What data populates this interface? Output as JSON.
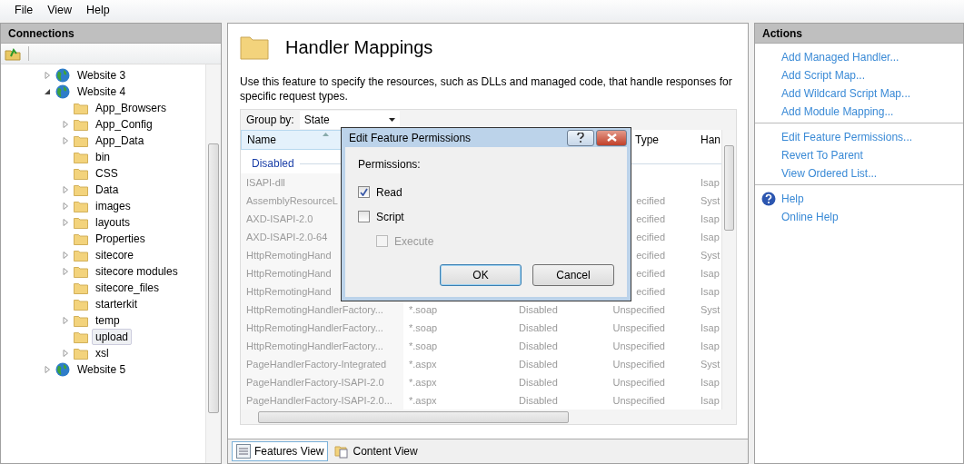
{
  "menu": [
    "File",
    "View",
    "Help"
  ],
  "connections": {
    "title": "Connections",
    "tree": [
      {
        "label": "Website 3",
        "kind": "site",
        "expanded": false,
        "selected": false
      },
      {
        "label": "Website 4",
        "kind": "site",
        "expanded": true,
        "selected": false,
        "children": [
          {
            "label": "App_Browsers",
            "kind": "folder",
            "selected": false
          },
          {
            "label": "App_Config",
            "kind": "folder",
            "expanded": false,
            "selected": false
          },
          {
            "label": "App_Data",
            "kind": "folder",
            "expanded": false,
            "selected": false
          },
          {
            "label": "bin",
            "kind": "folder",
            "selected": false
          },
          {
            "label": "CSS",
            "kind": "folder",
            "selected": false
          },
          {
            "label": "Data",
            "kind": "folder",
            "expanded": false,
            "selected": false
          },
          {
            "label": "images",
            "kind": "folder",
            "expanded": false,
            "selected": false
          },
          {
            "label": "layouts",
            "kind": "folder",
            "expanded": false,
            "selected": false
          },
          {
            "label": "Properties",
            "kind": "folder",
            "selected": false
          },
          {
            "label": "sitecore",
            "kind": "folder",
            "expanded": false,
            "selected": false
          },
          {
            "label": "sitecore modules",
            "kind": "folder",
            "expanded": false,
            "selected": false
          },
          {
            "label": "sitecore_files",
            "kind": "folder",
            "selected": false
          },
          {
            "label": "starterkit",
            "kind": "folder",
            "selected": false
          },
          {
            "label": "temp",
            "kind": "folder",
            "expanded": false,
            "selected": false
          },
          {
            "label": "upload",
            "kind": "folder",
            "selected": true
          },
          {
            "label": "xsl",
            "kind": "folder",
            "expanded": false,
            "selected": false
          }
        ]
      },
      {
        "label": "Website 5",
        "kind": "site",
        "expanded": false,
        "selected": false
      }
    ]
  },
  "feature": {
    "title": "Handler Mappings",
    "description": "Use this feature to specify the resources, such as DLLs and managed code, that handle responses for specific request types.",
    "group_by": {
      "label": "Group by:",
      "value": "State"
    },
    "table": {
      "columns": [
        {
          "label": "Name",
          "sorted": true
        },
        {
          "label": "Type",
          "sorted": false
        },
        {
          "label": "Han",
          "sorted": false
        }
      ],
      "group": "Disabled",
      "rows": [
        {
          "name": "ISAPI-dll",
          "handler": "Isap"
        },
        {
          "name": "AssemblyResourceL",
          "type": "ecified",
          "handler": "Syst"
        },
        {
          "name": "AXD-ISAPI-2.0",
          "type": "ecified",
          "handler": "Isap"
        },
        {
          "name": "AXD-ISAPI-2.0-64",
          "type": "ecified",
          "handler": "Isap"
        },
        {
          "name": "HttpRemotingHand",
          "type": "ecified",
          "handler": "Syst"
        },
        {
          "name": "HttpRemotingHand",
          "type": "ecified",
          "handler": "Isap"
        },
        {
          "name": "HttpRemotingHand",
          "type": "ecified",
          "handler": "Isap"
        },
        {
          "name": "HttpRemotingHandlerFactory...",
          "path": "*.soap",
          "state": "Disabled",
          "type": "Unspecified",
          "handler": "Syst"
        },
        {
          "name": "HttpRemotingHandlerFactory...",
          "path": "*.soap",
          "state": "Disabled",
          "type": "Unspecified",
          "handler": "Isap"
        },
        {
          "name": "HttpRemotingHandlerFactory...",
          "path": "*.soap",
          "state": "Disabled",
          "type": "Unspecified",
          "handler": "Isap"
        },
        {
          "name": "PageHandlerFactory-Integrated",
          "path": "*.aspx",
          "state": "Disabled",
          "type": "Unspecified",
          "handler": "Syst"
        },
        {
          "name": "PageHandlerFactory-ISAPI-2.0",
          "path": "*.aspx",
          "state": "Disabled",
          "type": "Unspecified",
          "handler": "Isap"
        },
        {
          "name": "PageHandlerFactory-ISAPI-2.0...",
          "path": "*.aspx",
          "state": "Disabled",
          "type": "Unspecified",
          "handler": "Isap"
        }
      ]
    }
  },
  "dialog": {
    "title": "Edit Feature Permissions",
    "label": "Permissions:",
    "options": [
      {
        "label": "Read",
        "checked": true,
        "disabled": false
      },
      {
        "label": "Script",
        "checked": false,
        "disabled": false,
        "children": [
          {
            "label": "Execute",
            "checked": false,
            "disabled": true
          }
        ]
      }
    ],
    "buttons": [
      {
        "label": "OK",
        "default": true
      },
      {
        "label": "Cancel",
        "default": false
      }
    ]
  },
  "view_tabs": [
    {
      "label": "Features View",
      "selected": true
    },
    {
      "label": "Content View",
      "selected": false
    }
  ],
  "actions": {
    "title": "Actions",
    "groups": [
      [
        {
          "label": "Add Managed Handler...",
          "icon": false
        },
        {
          "label": "Add Script Map...",
          "icon": false
        },
        {
          "label": "Add Wildcard Script Map...",
          "icon": false
        },
        {
          "label": "Add Module Mapping...",
          "icon": false
        }
      ],
      [
        {
          "label": "Edit Feature Permissions...",
          "icon": false
        },
        {
          "label": "Revert To Parent",
          "icon": false
        },
        {
          "label": "View Ordered List...",
          "icon": false
        }
      ],
      [
        {
          "label": "Help",
          "icon": true
        },
        {
          "label": "Online Help",
          "icon": false
        }
      ]
    ]
  }
}
